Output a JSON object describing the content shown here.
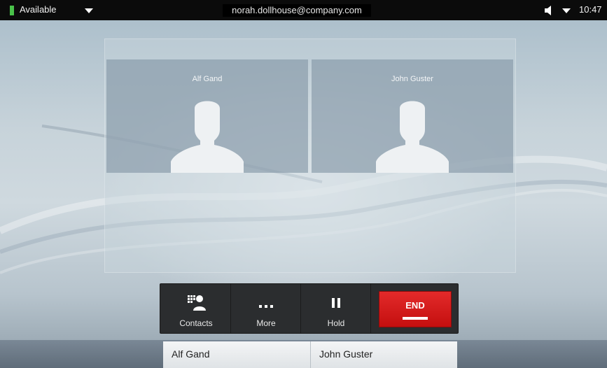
{
  "status_bar": {
    "presence": "Available",
    "account": "norah.dollhouse@company.com",
    "time": "10:47"
  },
  "call": {
    "participants": [
      {
        "name": "Alf Gand"
      },
      {
        "name": "John Guster"
      }
    ]
  },
  "controls": {
    "contacts_label": "Contacts",
    "more_label": "More",
    "hold_label": "Hold",
    "end_label": "END"
  },
  "participant_strip": [
    {
      "name": "Alf Gand"
    },
    {
      "name": "John Guster"
    }
  ],
  "icons": {
    "presence": "status-indicator-icon",
    "presence_menu": "chevron-down-icon",
    "speaker": "speaker-icon",
    "volume_menu": "chevron-down-icon",
    "avatar": "person-silhouette-icon",
    "contacts": "contacts-icon",
    "more": "ellipsis-icon",
    "hold": "pause-icon",
    "end": "end-call-icon"
  },
  "colors": {
    "presence_available": "#49c24a",
    "end_button": "#d01818",
    "status_bar": "#0b0b0b",
    "control_bar": "#2b2d2f"
  }
}
